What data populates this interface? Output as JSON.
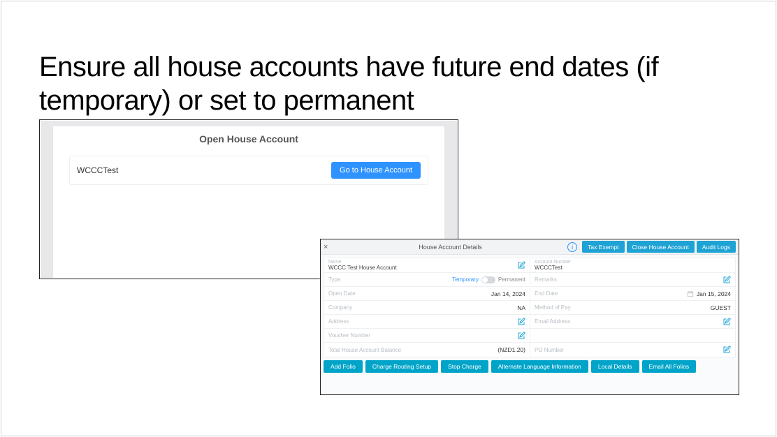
{
  "heading": "Ensure all house accounts have future end dates (if temporary) or set to permanent",
  "panel1": {
    "title": "Open House Account",
    "row_label": "WCCCTest",
    "go_btn": "Go to House Account"
  },
  "panel2": {
    "title": "House Account Details",
    "hdr_buttons": {
      "tax_exempt": "Tax Exempt",
      "close": "Close House Account",
      "audit": "Audit Logs"
    },
    "fields": {
      "name_label": "Name",
      "name_value": "WCCC Test House Account",
      "acct_label": "Account Number",
      "acct_value": "WCCCTest",
      "type_label": "Type",
      "type_temp": "Temporary",
      "type_perm": "Permanent",
      "remarks_label": "Remarks",
      "open_date_label": "Open Date",
      "open_date_value": "Jan 14, 2024",
      "end_date_label": "End Date",
      "end_date_value": "Jan 15, 2024",
      "company_label": "Company",
      "company_value": "NA",
      "method_label": "Method of Pay",
      "method_value": "GUEST",
      "address_label": "Address",
      "email_label": "Email Address",
      "voucher_label": "Voucher Number",
      "balance_label": "Total House Account Balance",
      "balance_value": "(NZD1.20)",
      "po_label": "PO Number"
    },
    "footer": {
      "add_folio": "Add Folio",
      "charge_routing": "Charge Routing Setup",
      "stop_charge": "Stop Charge",
      "alt_lang": "Alternate Language Information",
      "local_details": "Local Details",
      "email_all": "Email All Folios"
    }
  }
}
